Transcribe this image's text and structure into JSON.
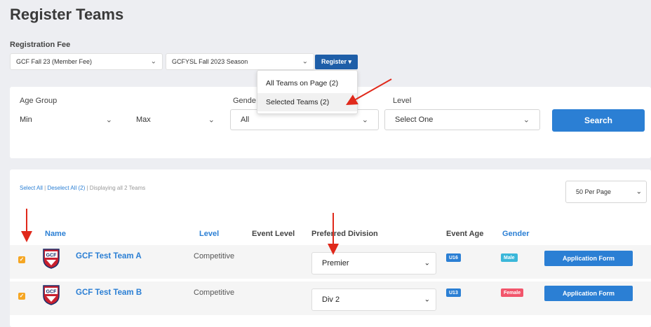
{
  "page_title": "Register Teams",
  "registration_fee": {
    "label": "Registration Fee",
    "fee_select": "GCF Fall 23 (Member Fee)",
    "season_select": "GCFYSL Fall 2023 Season",
    "register_button": "Register ▾"
  },
  "register_menu": {
    "items": [
      "All Teams on Page (2)",
      "Selected Teams (2)"
    ]
  },
  "filters": {
    "age_group_label": "Age Group",
    "min": "Min",
    "max": "Max",
    "gender_label": "Gende",
    "gender_value": "All",
    "level_label": "Level",
    "level_value": "Select One",
    "search_button": "Search"
  },
  "list": {
    "select_all": "Select All",
    "separator": "|",
    "deselect_all": "Deselect All (2)",
    "displaying": "Displaying all 2 Teams",
    "per_page": "50 Per Page",
    "columns": {
      "name": "Name",
      "level": "Level",
      "event_level": "Event Level",
      "preferred_division": "Preferred Division",
      "event_age": "Event Age",
      "gender": "Gender"
    },
    "rows": [
      {
        "checked": "✓",
        "logo": "GCF",
        "team": "GCF Test Team A",
        "level": "Competitive",
        "division": "Premier",
        "age_badge": "U16",
        "gender_badge": "Male",
        "app_button": "Application Form"
      },
      {
        "checked": "✓",
        "logo": "GCF",
        "team": "GCF Test Team B",
        "level": "Competitive",
        "division": "Div 2",
        "age_badge": "U13",
        "gender_badge": "Female",
        "app_button": "Application Form"
      }
    ]
  },
  "colors": {
    "primary": "#2b7fd4",
    "register_btn": "#1e5ea8",
    "checkbox": "#f5a623",
    "badge_age": "#2b7fd4",
    "badge_male": "#3bb7d9",
    "badge_female": "#f2556b",
    "annotation_arrow": "#e0291b"
  }
}
